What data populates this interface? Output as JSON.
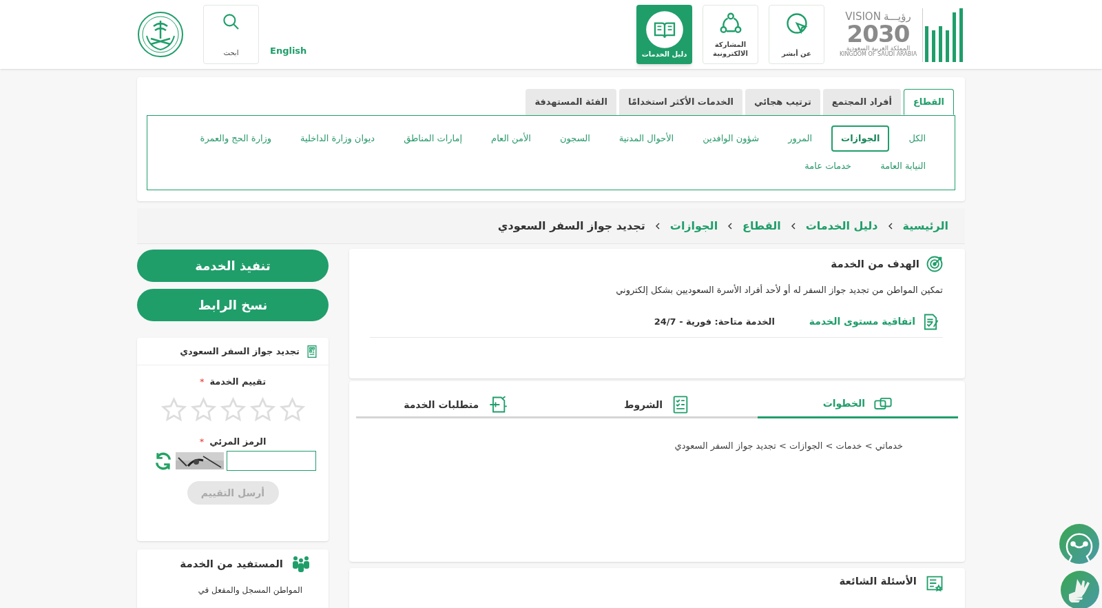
{
  "header": {
    "vision_logo": {
      "arabic": "رؤيـــة",
      "latin": "VISION",
      "year": "2030",
      "country_ar": "المملكة العربية السعودية",
      "country_en": "KINGDOM OF SAUDI ARABIA"
    },
    "nav": [
      {
        "label": "عن أبشر",
        "kind": "cursor",
        "selected": false
      },
      {
        "label": "المشاركة الالكترونية",
        "kind": "share",
        "selected": false
      },
      {
        "label": "دليل الخدمات",
        "kind": "book",
        "selected": true
      }
    ],
    "language": "English",
    "search": "ابحث"
  },
  "category_tabs": [
    {
      "label": "القطاع",
      "selected": true
    },
    {
      "label": "أفراد المجتمع",
      "selected": false
    },
    {
      "label": "ترتيب هجائي",
      "selected": false
    },
    {
      "label": "الخدمات الأكثر استخدامًا",
      "selected": false
    },
    {
      "label": "الفئة المستهدفة",
      "selected": false
    }
  ],
  "sectors": [
    {
      "label": "الكل",
      "selected": false
    },
    {
      "label": "الجوازات",
      "selected": true
    },
    {
      "label": "المرور",
      "selected": false
    },
    {
      "label": "شؤون الوافدين",
      "selected": false
    },
    {
      "label": "الأحوال المدنية",
      "selected": false
    },
    {
      "label": "السجون",
      "selected": false
    },
    {
      "label": "الأمن العام",
      "selected": false
    },
    {
      "label": "إمارات المناطق",
      "selected": false
    },
    {
      "label": "ديوان وزارة الداخلية",
      "selected": false
    },
    {
      "label": "وزارة الحج والعمرة",
      "selected": false
    },
    {
      "label": "النيابة العامة",
      "selected": false
    },
    {
      "label": "خدمات عامة",
      "selected": false
    }
  ],
  "breadcrumb": [
    "الرئيسية",
    "دليل الخدمات",
    "القطاع",
    "الجوازات",
    "تجديد جواز السفر السعودي"
  ],
  "actions": [
    "تنفيذ الخدمة",
    "نسخ الرابط"
  ],
  "rating_card": {
    "title": "تجديد جواز السفر السعودي",
    "rating_label": "تقييم الخدمة",
    "required_mark": "*",
    "stars": 0,
    "captcha_label": "الرمز المرئي",
    "captcha_required_mark": "*",
    "submit": "أرسل التقييم",
    "submit_disabled": true
  },
  "beneficiary": {
    "title": "المستفيد من الخدمة",
    "text": "المواطن المسجل والمفعل في"
  },
  "goal": {
    "title": "الهدف من الخدمة",
    "text": "تمكين المواطن من تجديد جواز السفر له أو لأحد أفراد الأسرة السعوديين بشكل إلكتروني",
    "sla_link": "اتفاقية مستوى الخدمة",
    "availability": "الخدمة متاحة: فورية - 24/7"
  },
  "detail_tabs": [
    {
      "label": "الخطوات",
      "kind": "steps",
      "selected": true
    },
    {
      "label": "الشروط",
      "kind": "terms",
      "selected": false
    },
    {
      "label": "متطلبات الخدمة",
      "kind": "requirements",
      "selected": false
    }
  ],
  "steps_text": "خدماتي > خدمات > الجوازات > تجديد جواز السفر السعودي",
  "faq": {
    "title": "الأسئلة الشائعة"
  }
}
